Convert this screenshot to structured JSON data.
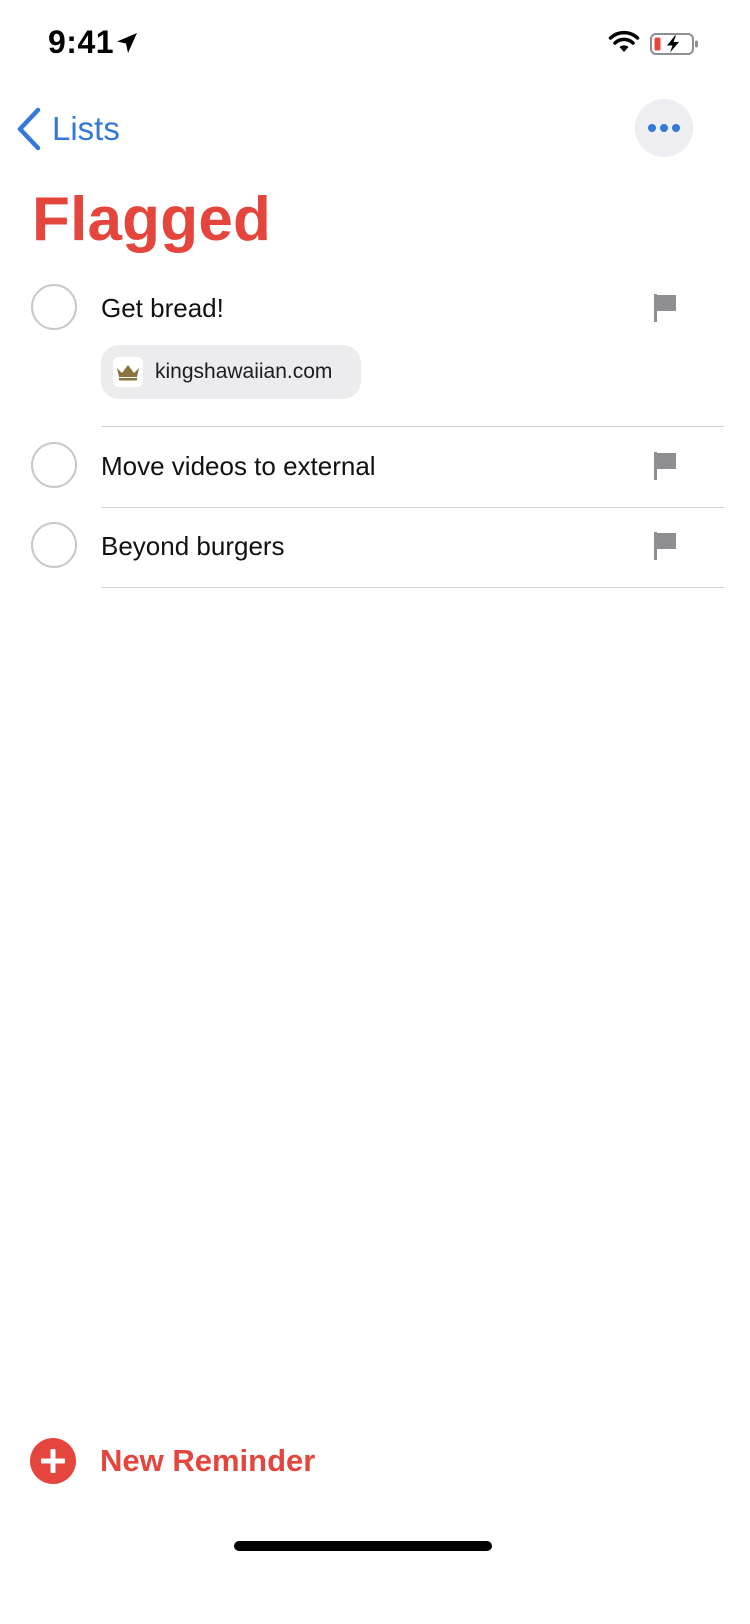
{
  "status_bar": {
    "time": "9:41",
    "icons": [
      "location-arrow-icon",
      "wifi-icon",
      "battery-charging-icon"
    ],
    "battery_level": 0.15
  },
  "nav": {
    "back_label": "Lists",
    "back_icon": "chevron-left-icon",
    "more_icon": "ellipsis-icon"
  },
  "title": "Flagged",
  "reminders": [
    {
      "title": "Get bread!",
      "flagged": true,
      "link": {
        "label": "kingshawaiian.com",
        "icon": "crown-favicon-icon"
      }
    },
    {
      "title": "Move videos to external",
      "flagged": true
    },
    {
      "title": "Beyond burgers",
      "flagged": true
    }
  ],
  "new_reminder": {
    "label": "New Reminder",
    "icon": "plus-circle-icon"
  },
  "colors": {
    "accent_red": "#e4453d",
    "link_blue": "#3478d8",
    "flag_gray": "#8e8e93",
    "circle_gray": "#c8c8cc"
  }
}
